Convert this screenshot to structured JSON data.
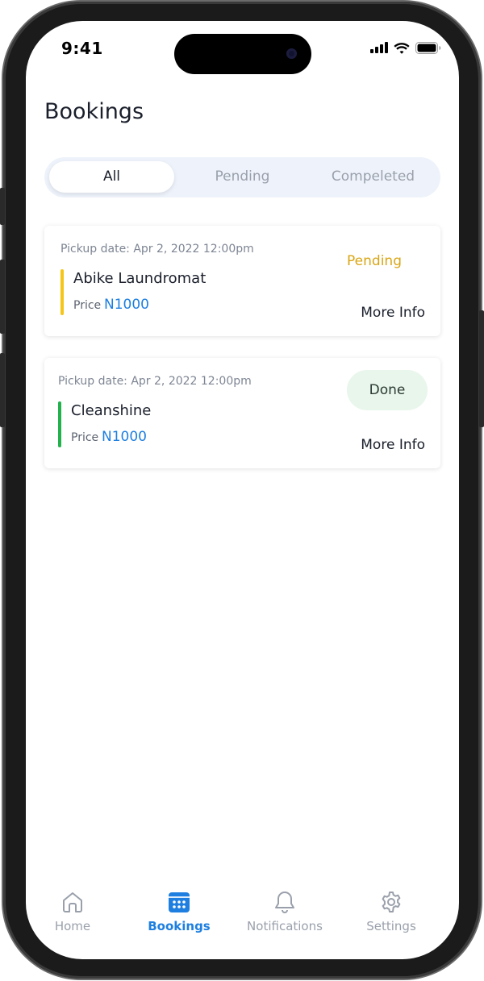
{
  "status_bar": {
    "time": "9:41",
    "icons": [
      "cellular-signal-icon",
      "wifi-icon",
      "battery-icon"
    ]
  },
  "page": {
    "title": "Bookings"
  },
  "filter_tabs": [
    {
      "label": "All",
      "active": true
    },
    {
      "label": "Pending",
      "active": false
    },
    {
      "label": "Compeleted",
      "active": false
    }
  ],
  "bookings": [
    {
      "pickup": "Pickup date: Apr 2, 2022 12:00pm",
      "vendor": "Abike Laundromat",
      "price_label": "Price",
      "price": "N1000",
      "status": "Pending",
      "status_color": "#d9a514",
      "accent_color": "#f5c518",
      "action": "More Info"
    },
    {
      "pickup": "Pickup date: Apr 2, 2022 12:00pm",
      "vendor": "Cleanshine",
      "price_label": "Price",
      "price": "N1000",
      "status": "Done",
      "status_color": "#2b3a32",
      "accent_color": "#22b14c",
      "action": "More Info"
    }
  ],
  "tab_bar": [
    {
      "label": "Home",
      "icon": "home-icon",
      "active": false
    },
    {
      "label": "Bookings",
      "icon": "calendar-icon",
      "active": true
    },
    {
      "label": "Notifications",
      "icon": "bell-icon",
      "active": false
    },
    {
      "label": "Settings",
      "icon": "gear-icon",
      "active": false
    }
  ],
  "colors": {
    "accent": "#1e7fe0",
    "pending": "#d9a514",
    "done_background": "#e8f6ec",
    "segmented_background": "#eef3fb"
  }
}
